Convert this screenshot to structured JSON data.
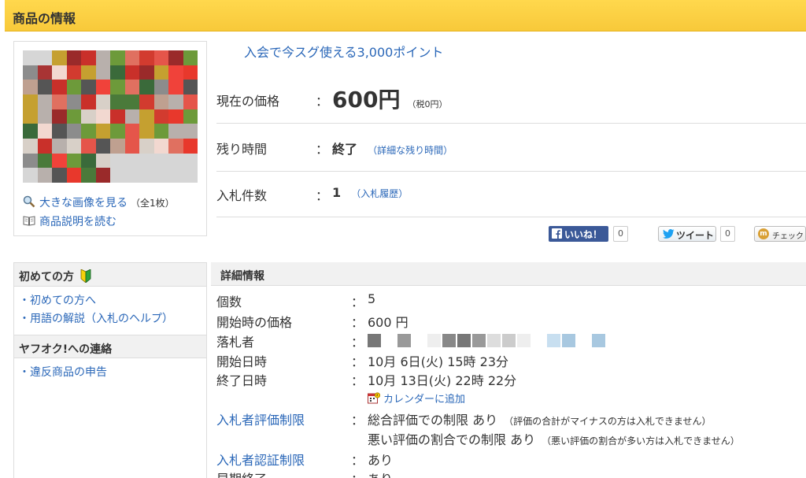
{
  "header": {
    "title": "商品の情報"
  },
  "thumbnail": {
    "enlarge_link": "大きな画像を見る",
    "image_count": "（全1枚）",
    "description_link": "商品説明を読む"
  },
  "promo_link": "入会で今スグ使える3,000ポイント",
  "price": {
    "current_label": "現在の価格",
    "current_value": "600円",
    "tax_note": "（税0円）",
    "remaining_label": "残り時間",
    "remaining_value": "終了",
    "remaining_link": "（詳細な残り時間）",
    "bids_label": "入札件数",
    "bids_value": "1",
    "bid_history_link": "（入札履歴）",
    "colon": "："
  },
  "social": {
    "fb_like": "いいね！",
    "fb_count": "0",
    "tweet": "ツイート",
    "tweet_count": "0",
    "mixi_check": "チェック"
  },
  "sidebar": {
    "first_time_heading": "初めての方",
    "first_time_items": [
      "・初めての方へ",
      "・用語の解説（入札のヘルプ）"
    ],
    "contact_heading": "ヤフオク!への連絡",
    "contact_items": [
      "・違反商品の申告"
    ]
  },
  "details": {
    "heading": "詳細情報",
    "quantity_label": "個数",
    "quantity_value": "5",
    "start_price_label": "開始時の価格",
    "start_price_value": "600 円",
    "winner_label": "落札者",
    "start_date_label": "開始日時",
    "start_date_value": "10月 6日(火) 15時 23分",
    "end_date_label": "終了日時",
    "end_date_value": "10月 13日(火) 22時 22分",
    "calendar_link": "カレンダーに追加",
    "rating_limit_label": "入札者評価制限",
    "rating_limit_1": "総合評価での制限 あり",
    "rating_limit_1_note": "（評価の合計がマイナスの方は入札できません）",
    "rating_limit_2": "悪い評価の割合での制限 あり",
    "rating_limit_2_note": "（悪い評価の割合が多い方は入札できません）",
    "verification_label": "入札者認証制限",
    "verification_value": "あり",
    "early_end_label": "早期終了",
    "early_end_value": "あり"
  },
  "colors": {
    "link": "#2a67b8",
    "header": "#f8c93a",
    "fb": "#3b5998"
  }
}
